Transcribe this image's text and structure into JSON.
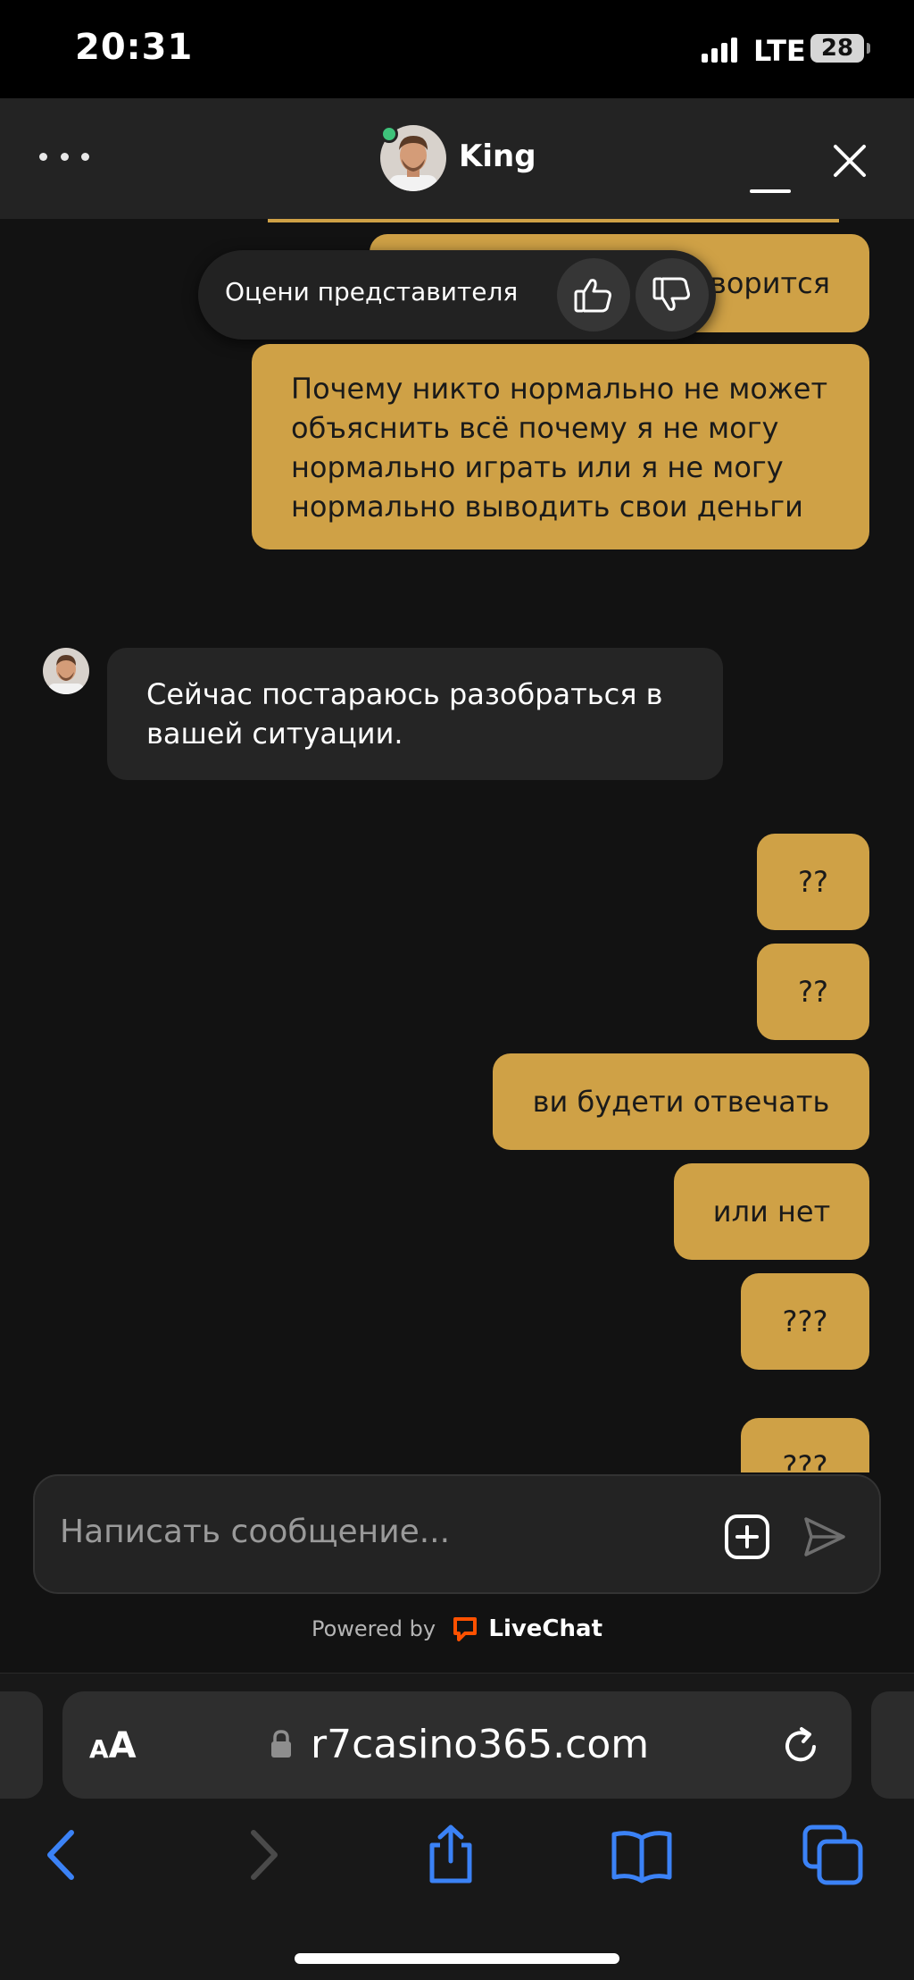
{
  "status_bar": {
    "time": "20:31",
    "network": "LTE",
    "battery": "28"
  },
  "chat_header": {
    "agent_name": "King"
  },
  "rating": {
    "prompt": "Оцени представителя"
  },
  "messages": [
    {
      "from": "visitor",
      "text": "ворится"
    },
    {
      "from": "visitor",
      "text": "Почему никто нормально не может объяснить всё почему я не могу нормально играть или я не могу нормально выводить свои деньги"
    },
    {
      "from": "agent",
      "text": "Сейчас постараюсь разобраться в вашей ситуации."
    },
    {
      "from": "visitor",
      "text": "??"
    },
    {
      "from": "visitor",
      "text": "??"
    },
    {
      "from": "visitor",
      "text": "ви будети отвечать"
    },
    {
      "from": "visitor",
      "text": "или нет"
    },
    {
      "from": "visitor",
      "text": "???"
    },
    {
      "from": "visitor",
      "text": "???"
    }
  ],
  "composer": {
    "placeholder": "Написать сообщение..."
  },
  "footer": {
    "powered_by": "Powered by",
    "brand": "LiveChat",
    "brand_color": "#ff5100"
  },
  "browser": {
    "aa_small": "A",
    "aa_large": "A",
    "url": "r7casino365.com",
    "accent_color": "#3b82f6"
  }
}
